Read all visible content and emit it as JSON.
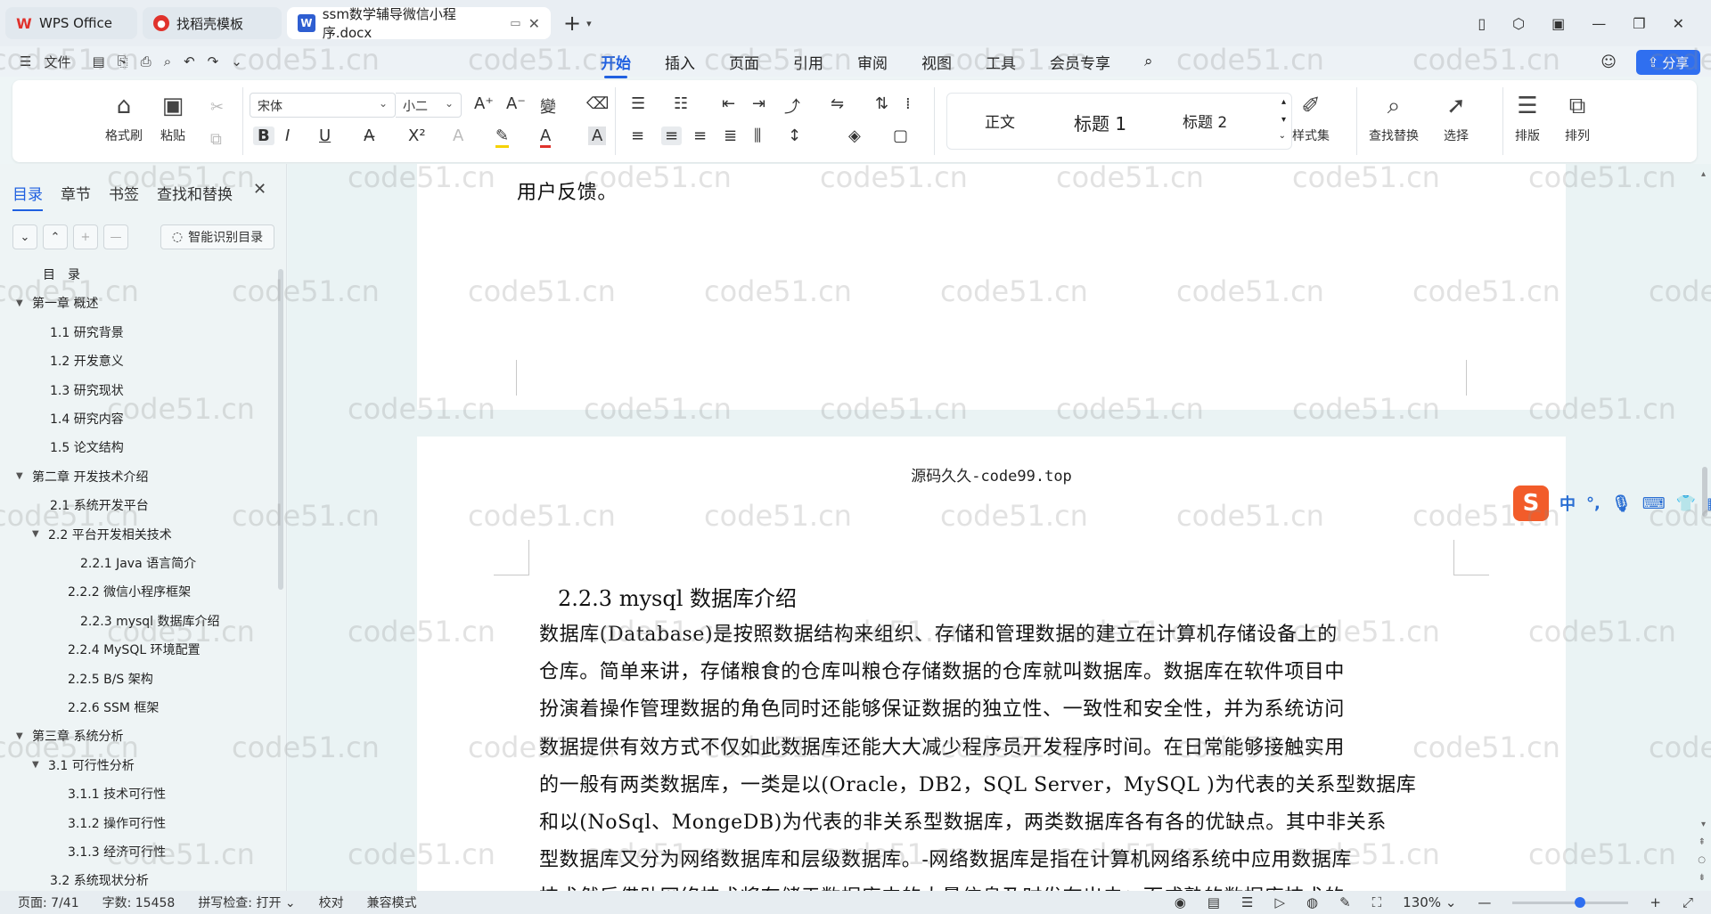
{
  "titlebar": {
    "tabs": [
      {
        "label": "WPS Office",
        "icon": "wps-logo-icon"
      },
      {
        "label": "找稻壳模板",
        "icon": "docer-logo-icon"
      },
      {
        "label": "ssm数学辅导微信小程序.docx",
        "icon": "word-doc-icon"
      }
    ],
    "new_tab": "+"
  },
  "menubar": {
    "file_label": "文件",
    "tabs": [
      "开始",
      "插入",
      "页面",
      "引用",
      "审阅",
      "视图",
      "工具",
      "会员专享"
    ],
    "active_tab": "开始",
    "share_label": "分享"
  },
  "ribbon": {
    "format_painter": "格式刷",
    "paste": "粘贴",
    "font_name": "宋体",
    "font_size": "小二",
    "styles": [
      "正文",
      "标题 1",
      "标题 2"
    ],
    "style_set": "样式集",
    "find_replace": "查找替换",
    "select": "选择",
    "layout": "排版",
    "arrange": "排列"
  },
  "nav": {
    "tabs": [
      "目录",
      "章节",
      "书签",
      "查找和替换"
    ],
    "active_tab": "目录",
    "smart_button": "智能识别目录",
    "toc": [
      {
        "label": "目　录",
        "level": 0,
        "arrow": ""
      },
      {
        "label": "第一章  概述",
        "level": 0,
        "arrow": "▼"
      },
      {
        "label": "1.1  研究背景",
        "level": 1,
        "arrow": ""
      },
      {
        "label": "1.2  开发意义",
        "level": 1,
        "arrow": ""
      },
      {
        "label": "1.3  研究现状",
        "level": 1,
        "arrow": ""
      },
      {
        "label": "1.4  研究内容",
        "level": 1,
        "arrow": ""
      },
      {
        "label": "1.5  论文结构",
        "level": 1,
        "arrow": ""
      },
      {
        "label": "第二章  开发技术介绍",
        "level": 0,
        "arrow": "▼"
      },
      {
        "label": "2.1  系统开发平台",
        "level": 1,
        "arrow": ""
      },
      {
        "label": "2.2  平台开发相关技术",
        "level": 1,
        "arrow": "▼"
      },
      {
        "label": "2.2.1    Java 语言简介",
        "level": 3,
        "arrow": ""
      },
      {
        "label": "2.2.2    微信小程序框架",
        "level": 2,
        "arrow": ""
      },
      {
        "label": "2.2.3    mysql 数据库介绍",
        "level": 3,
        "arrow": ""
      },
      {
        "label": "2.2.4    MySQL 环境配置",
        "level": 2,
        "arrow": ""
      },
      {
        "label": "2.2.5    B/S 架构",
        "level": 2,
        "arrow": ""
      },
      {
        "label": "2.2.6    SSM 框架",
        "level": 2,
        "arrow": ""
      },
      {
        "label": "第三章  系统分析",
        "level": 0,
        "arrow": "▼"
      },
      {
        "label": "3.1  可行性分析",
        "level": 1,
        "arrow": "▼"
      },
      {
        "label": "3.1.1  技术可行性",
        "level": 2,
        "arrow": ""
      },
      {
        "label": "3.1.2  操作可行性",
        "level": 2,
        "arrow": ""
      },
      {
        "label": "3.1.3  经济可行性",
        "level": 2,
        "arrow": ""
      },
      {
        "label": "3.2  系统现状分析",
        "level": 1,
        "arrow": ""
      }
    ]
  },
  "document": {
    "page1_text": "用户反馈。",
    "page2_header": "源码久久-code99.top",
    "heading": "2.2.3    mysql 数据库介绍",
    "body_lines": [
      "    数据库(Database)是按照数据结构来组织、存储和管理数据的建立在计算机存储设备上的",
      "仓库。简单来讲，存储粮食的仓库叫粮仓存储数据的仓库就叫数据库。数据库在软件项目中",
      "扮演着操作管理数据的角色同时还能够保证数据的独立性、一致性和安全性，并为系统访问",
      "数据提供有效方式不仅如此数据库还能大大减少程序员开发程序时间。在日常能够接触实用",
      "的一般有两类数据库，一类是以(Oracle，DB2，SQL Server，MySQL )为代表的关系型数据库",
      "和以(NoSql、MongeDB)为代表的非关系型数据库，两类数据库各有各的优缺点。其中非关系",
      "型数据库又分为网络数据库和层级数据库。-网络数据库是指在计算机网络系统中应用数据库",
      "技术然后借助网络技术将存储于数据库中的大量信息及时发布出去；而成熟的数据库技术的"
    ]
  },
  "ime": {
    "lang": "中"
  },
  "statusbar": {
    "page": "页面: 7/41",
    "words": "字数: 15458",
    "spellcheck": "拼写检查: 打开",
    "proofread": "校对",
    "compat": "兼容模式",
    "zoom": "130%"
  },
  "watermark": "code51.cn"
}
